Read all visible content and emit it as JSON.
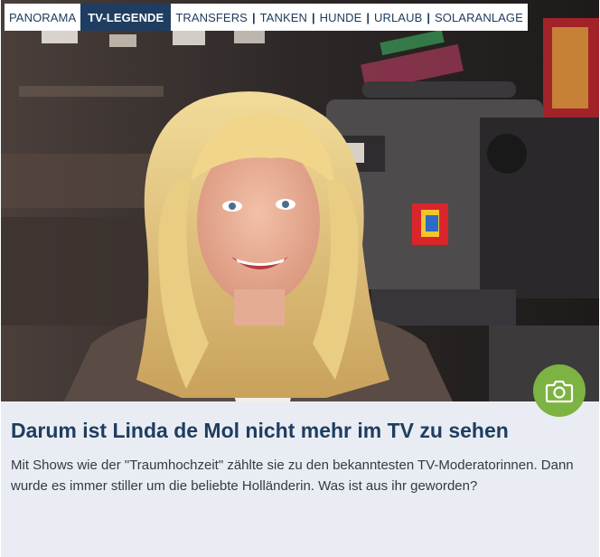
{
  "nav": {
    "tags": [
      {
        "label": "PANORAMA",
        "active": false
      },
      {
        "label": "TV-LEGENDE",
        "active": true
      },
      {
        "label": "TRANSFERS",
        "active": false
      },
      {
        "label": "TANKEN",
        "active": false
      },
      {
        "label": "HUNDE",
        "active": false
      },
      {
        "label": "URLAUB",
        "active": false
      },
      {
        "label": "SOLARANLAGE",
        "active": false
      }
    ],
    "separator": "|"
  },
  "article": {
    "headline": "Darum ist Linda de Mol nicht mehr im TV zu sehen",
    "teaser": "Mit Shows wie der \"Traumhochzeit\" zählte sie zu den bekanntesten TV-Moderatorinnen. Dann wurde es immer stiller um die beliebte Holländerin. Was ist aus ihr geworden?"
  },
  "gallery_button": {
    "icon": "camera-icon"
  },
  "colors": {
    "accent_green": "#7cb342",
    "navy": "#1f3d61",
    "card_bg": "#e9edf3"
  }
}
